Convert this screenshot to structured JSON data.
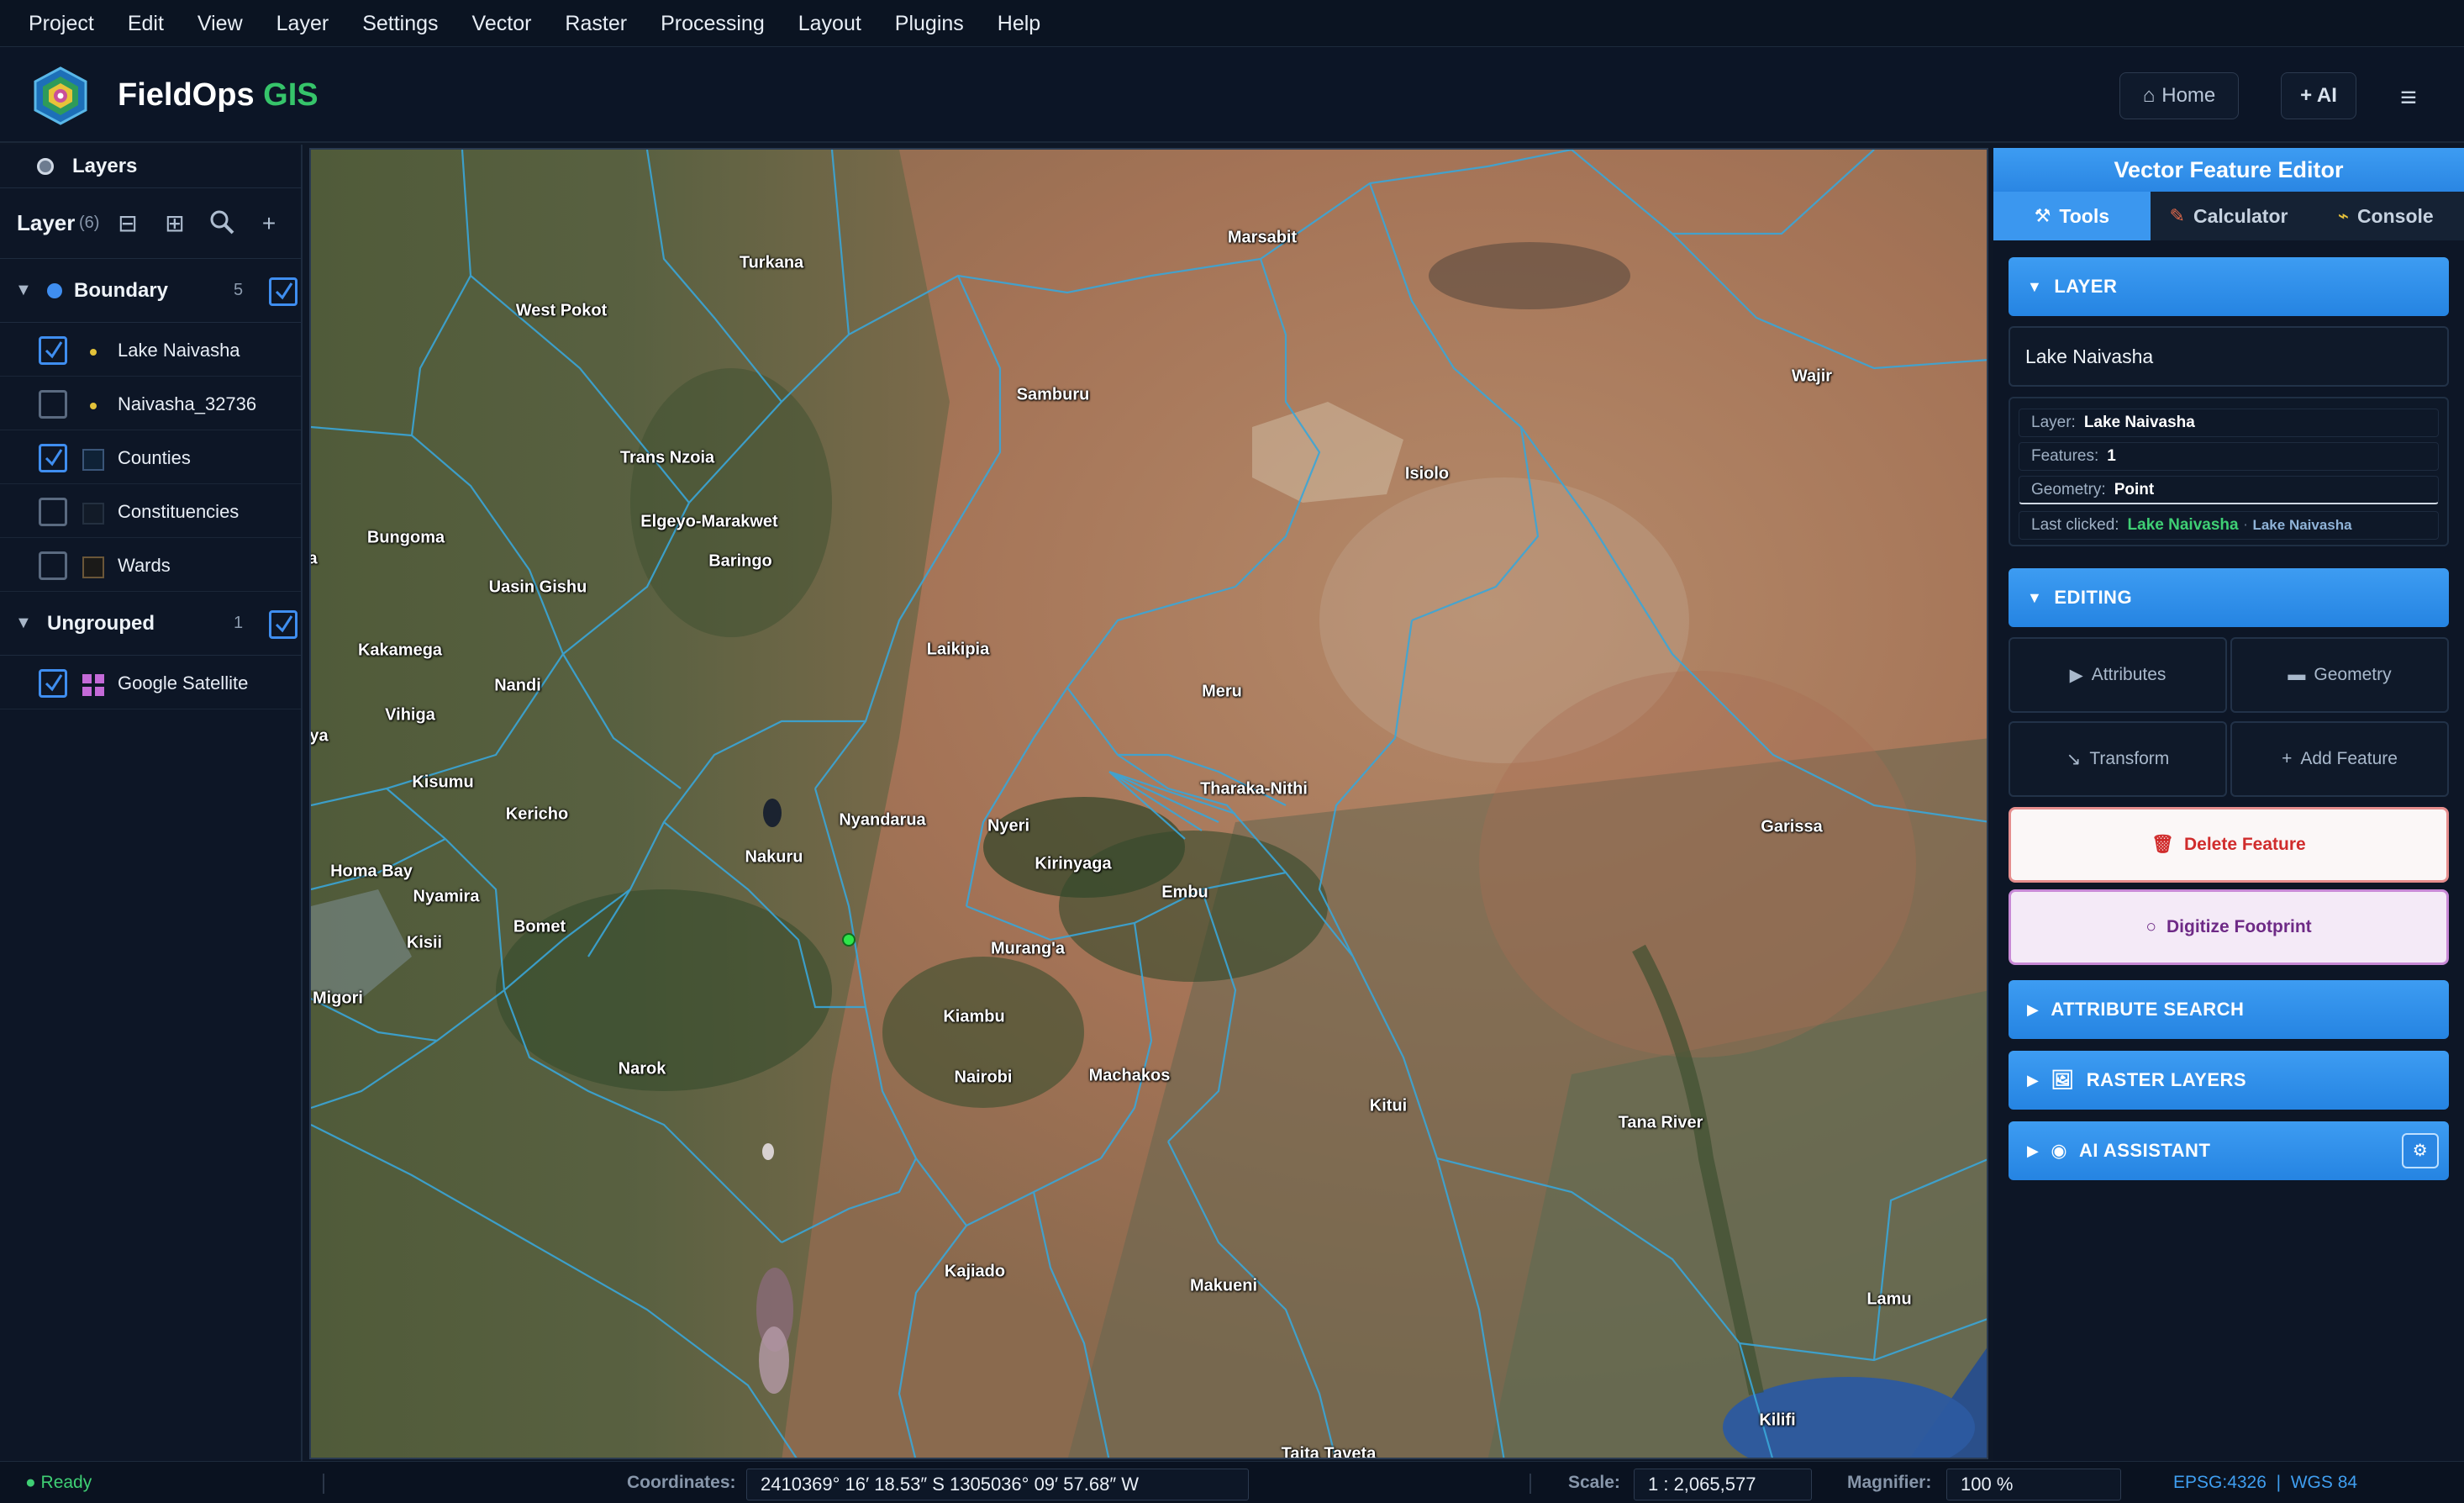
{
  "menu": [
    "Project",
    "Edit",
    "View",
    "Layer",
    "Settings",
    "Vector",
    "Raster",
    "Processing",
    "Layout",
    "Plugins",
    "Help"
  ],
  "header": {
    "app_name_main": "FieldOps",
    "app_name_accent": "GIS",
    "home_label": "Home",
    "ai_label": "+ AI"
  },
  "left_panel": {
    "title": "Layers",
    "layers_label": "Layers",
    "layers_count": "(6)",
    "groups": [
      {
        "name": "Boundary",
        "count": "5",
        "layers": [
          {
            "name": "Lake Naivasha",
            "checked": true
          },
          {
            "name": "Naivasha_32736",
            "checked": false
          },
          {
            "name": "Counties",
            "checked": true
          },
          {
            "name": "Constituencies",
            "checked": false
          },
          {
            "name": "Wards",
            "checked": false
          }
        ]
      },
      {
        "name": "Ungrouped",
        "count": "1",
        "layers": [
          {
            "name": "Google Satellite",
            "checked": true
          }
        ]
      }
    ]
  },
  "map": {
    "labels": [
      "Turkana",
      "Marsabit",
      "West Pokot",
      "Samburu",
      "Wajir",
      "Trans Nzoia",
      "Isiolo",
      "Bungoma",
      "Elgeyo-Marakwet",
      "Baringo",
      "Uasin Gishu",
      "Kakamega",
      "Laikipia",
      "Nandi",
      "Meru",
      "Vihiga",
      "Tharaka-Nithi",
      "Kisumu",
      "Kericho",
      "Nyandarua",
      "Nyeri",
      "Garissa",
      "Homa Bay",
      "Nakuru",
      "Kirinyaga",
      "Nyamira",
      "Embu",
      "Bomet",
      "Kisii",
      "Murang'a",
      "Migori",
      "Kiambu",
      "Narok",
      "Nairobi",
      "Machakos",
      "Kitui",
      "Tana River",
      "Kajiado",
      "Makueni",
      "Lamu",
      "Kilifi",
      "Taita Taveta",
      "a",
      "aya"
    ]
  },
  "right_panel": {
    "title": "Vector Feature Editor",
    "tabs": [
      "Tools",
      "Calculator",
      "Console"
    ],
    "sections": {
      "layer": "LAYER",
      "editing": "EDITING",
      "attribute_search": "ATTRIBUTE SEARCH",
      "raster_layers": "RASTER LAYERS",
      "ai_assistant": "AI ASSISTANT"
    },
    "layer_select_value": "Lake Naivasha",
    "info": {
      "layer_label": "Layer:",
      "layer_value": "Lake Naivasha",
      "features_label": "Features:",
      "features_value": "1",
      "geometry_label": "Geometry:",
      "geometry_value": "Point",
      "last_clicked_label": "Last clicked:",
      "last_clicked_value": "Lake Naivasha",
      "last_clicked_sub": "Lake Naivasha"
    },
    "buttons": {
      "attributes": "Attributes",
      "geometry": "Geometry",
      "transform": "Transform",
      "add_feature": "Add Feature",
      "delete_feature": "Delete Feature",
      "digitize_footprint": "Digitize Footprint"
    }
  },
  "status": {
    "ready": "Ready",
    "coordinates_label": "Coordinates:",
    "coordinates_value": "2410369° 16′ 18.53″ S   1305036° 09′ 57.68″ W",
    "scale_label": "Scale:",
    "scale_value": "1 : 2,065,577",
    "magnifier_label": "Magnifier:",
    "magnifier_value": "100 %",
    "crs": "EPSG:4326",
    "datum": "WGS 84"
  },
  "colors": {
    "accent_blue": "#3b97ef",
    "brand_green": "#36c46a",
    "boundary_line": "#3aa6d8",
    "danger": "#d02c2c",
    "digitize": "#6e2a86"
  }
}
